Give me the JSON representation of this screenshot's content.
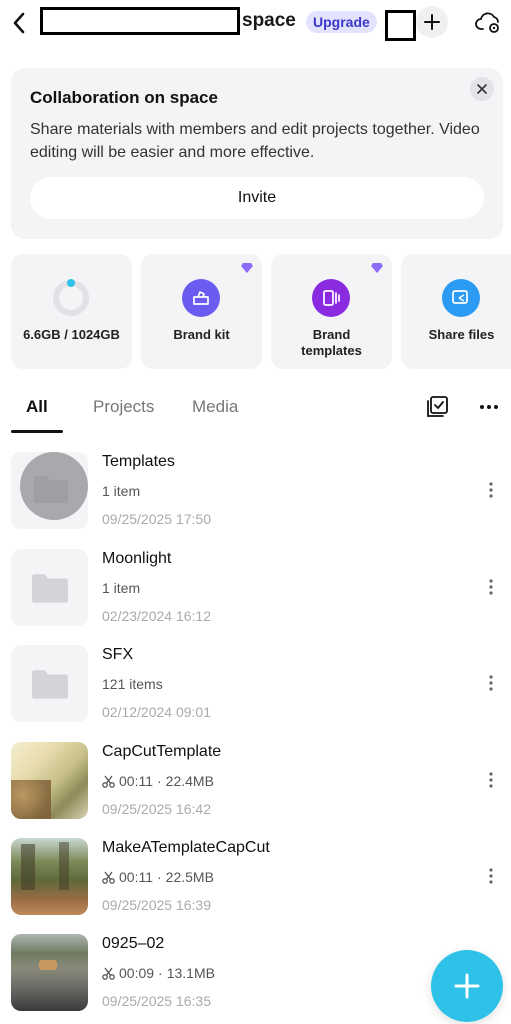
{
  "header": {
    "title": "space",
    "upgrade_label": "Upgrade"
  },
  "collab_card": {
    "title": "Collaboration on space",
    "description": "Share materials with members and edit projects together. Video editing will be easier and more effective.",
    "invite_label": "Invite"
  },
  "tiles": {
    "storage": {
      "label": "6.6GB / 1024GB",
      "used_fraction": 0.0064
    },
    "brand_kit": {
      "label": "Brand kit",
      "icon": "briefcase-icon",
      "color": "#6a5cf0"
    },
    "brand_templates": {
      "label": "Brand\ntemplates",
      "icon": "template-icon",
      "color": "#8a2be2"
    },
    "share_files": {
      "label": "Share files",
      "icon": "share-icon",
      "color": "#2b9bf4"
    }
  },
  "tabs": [
    {
      "label": "All",
      "active": true
    },
    {
      "label": "Projects",
      "active": false
    },
    {
      "label": "Media",
      "active": false
    }
  ],
  "files": [
    {
      "name": "Templates",
      "meta": "1 item",
      "date": "09/25/2025 17:50",
      "kind": "folder"
    },
    {
      "name": "Moonlight",
      "meta": "1 item",
      "date": "02/23/2024 16:12",
      "kind": "folder"
    },
    {
      "name": "SFX",
      "meta": "121 items",
      "date": "02/12/2024 09:01",
      "kind": "folder"
    },
    {
      "name": "CapCutTemplate",
      "duration": "00:11",
      "size": "22.4MB",
      "date": "09/25/2025 16:42",
      "kind": "video"
    },
    {
      "name": "MakeATemplateCapCut",
      "duration": "00:11",
      "size": "22.5MB",
      "date": "09/25/2025 16:39",
      "kind": "video"
    },
    {
      "name": "0925–02",
      "duration": "00:09",
      "size": "13.1MB",
      "date": "09/25/2025 16:35",
      "kind": "video"
    }
  ],
  "colors": {
    "accent": "#2ec2e8",
    "card_bg": "#f4f4f7",
    "upgrade_bg": "#e4e3ff",
    "upgrade_text": "#3c36c9"
  }
}
